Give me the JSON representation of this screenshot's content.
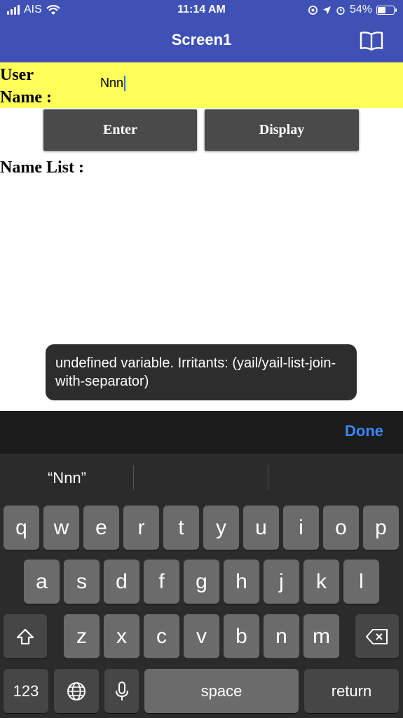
{
  "status_bar": {
    "carrier": "AIS",
    "time": "11:14 AM",
    "battery": "54%",
    "battery_fraction": 0.54
  },
  "app": {
    "title": "Screen1"
  },
  "form": {
    "user_label": "User Name :",
    "user_value": "Nnn",
    "enter_label": "Enter",
    "display_label": "Display",
    "list_label": "Name List :"
  },
  "toast": {
    "message": "undefined variable. Irritants: (yail/yail-list-join-with-separator)"
  },
  "keyboard": {
    "done_label": "Done",
    "suggestion": "“Nnn”",
    "row1": [
      "q",
      "w",
      "e",
      "r",
      "t",
      "y",
      "u",
      "i",
      "o",
      "p"
    ],
    "row2": [
      "a",
      "s",
      "d",
      "f",
      "g",
      "h",
      "j",
      "k",
      "l"
    ],
    "row3": [
      "z",
      "x",
      "c",
      "v",
      "b",
      "n",
      "m"
    ],
    "numbers_label": "123",
    "space_label": "space",
    "return_label": "return",
    "icons": {
      "shift": "shift-icon",
      "backspace": "backspace-icon",
      "globe": "globe-icon",
      "mic": "microphone-icon"
    }
  },
  "colors": {
    "header": "#3f51b5",
    "row_highlight": "#ffff59",
    "button": "#4a4a4a",
    "done": "#3b86f7"
  }
}
